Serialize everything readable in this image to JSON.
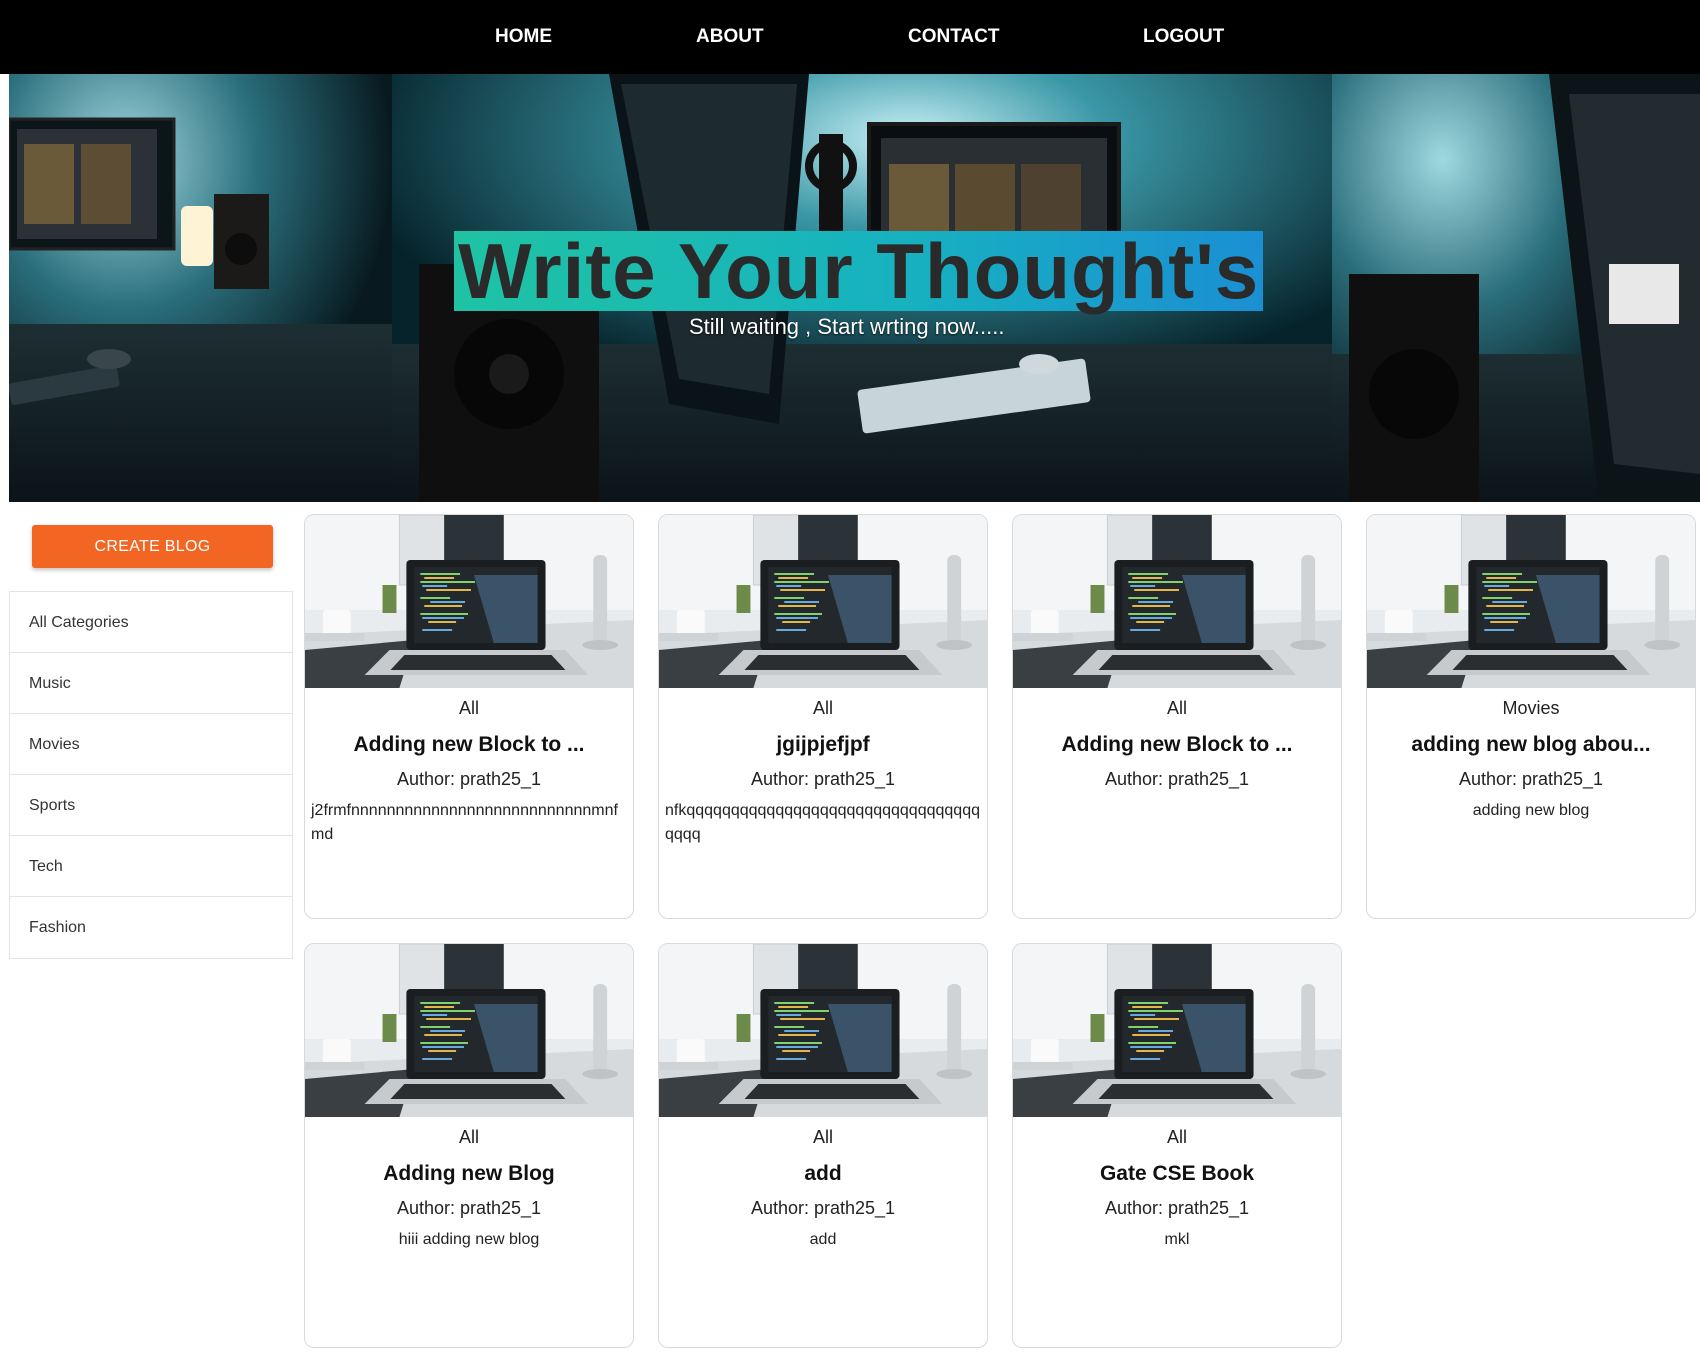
{
  "nav": {
    "items": [
      {
        "label": "HOME"
      },
      {
        "label": "ABOUT"
      },
      {
        "label": "CONTACT"
      },
      {
        "label": "LOGOUT"
      }
    ]
  },
  "hero": {
    "title": "Write Your Thought's",
    "subtitle": "Still waiting , Start wrting now....."
  },
  "sidebar": {
    "create_label": "CREATE BLOG",
    "categories": [
      "All Categories",
      "Music",
      "Movies",
      "Sports",
      "Tech",
      "Fashion"
    ]
  },
  "posts": [
    {
      "category": "All",
      "title": "Adding new Block to ...",
      "author": "Author: prath25_1",
      "description": "j2frmfnnnnnnnnnnnnnnnnnnnnnnnnnnnmnfmd"
    },
    {
      "category": "All",
      "title": "jgijpjefjpf",
      "author": "Author: prath25_1",
      "description": "nfkqqqqqqqqqqqqqqqqqqqqqqqqqqqqqqqqqqqqq"
    },
    {
      "category": "All",
      "title": "Adding new Block to ...",
      "author": "Author: prath25_1",
      "description": ""
    },
    {
      "category": "Movies",
      "title": "adding new blog abou...",
      "author": "Author: prath25_1",
      "description": "adding new blog"
    },
    {
      "category": "All",
      "title": "Adding new Blog",
      "author": "Author: prath25_1",
      "description": "hiii adding new blog"
    },
    {
      "category": "All",
      "title": "add",
      "author": "Author: prath25_1",
      "description": "add"
    },
    {
      "category": "All",
      "title": "Gate CSE Book",
      "author": "Author: prath25_1",
      "description": "mkl"
    }
  ],
  "colors": {
    "nav_bg": "#000000",
    "accent": "#f26522",
    "title_highlight_start": "#1fc3a3",
    "title_highlight_end": "#1b8fd3"
  }
}
